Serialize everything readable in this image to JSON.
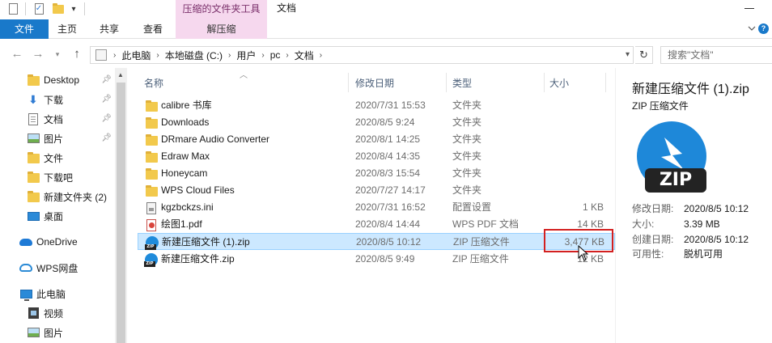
{
  "window": {
    "title": "文档",
    "context_tab_title": "压缩的文件夹工具"
  },
  "ribbon": {
    "tabs": [
      "文件",
      "主页",
      "共享",
      "查看",
      "解压缩"
    ]
  },
  "address": {
    "breadcrumbs": [
      "此电脑",
      "本地磁盘 (C:)",
      "用户",
      "pc",
      "文档"
    ],
    "search_placeholder": "搜索\"文档\""
  },
  "nav": {
    "items": [
      {
        "label": "Desktop",
        "icon": "folder-icon",
        "pinned": true
      },
      {
        "label": "下载",
        "icon": "download-icon",
        "pinned": true
      },
      {
        "label": "文档",
        "icon": "document-icon",
        "pinned": true
      },
      {
        "label": "图片",
        "icon": "picture-icon",
        "pinned": true
      },
      {
        "label": "文件",
        "icon": "folder-icon",
        "pinned": false
      },
      {
        "label": "下载吧",
        "icon": "folder-icon",
        "pinned": false
      },
      {
        "label": "新建文件夹 (2)",
        "icon": "folder-icon",
        "pinned": false
      },
      {
        "label": "桌面",
        "icon": "desktop-icon",
        "pinned": false
      },
      {
        "label": "OneDrive",
        "icon": "onedrive-icon",
        "pinned": false
      },
      {
        "label": "WPS网盘",
        "icon": "wps-cloud-icon",
        "pinned": false
      },
      {
        "label": "此电脑",
        "icon": "this-pc-icon",
        "pinned": false
      },
      {
        "label": "视频",
        "icon": "video-icon",
        "pinned": false
      },
      {
        "label": "图片",
        "icon": "picture-icon",
        "pinned": false
      }
    ]
  },
  "filelist": {
    "columns": [
      "名称",
      "修改日期",
      "类型",
      "大小"
    ],
    "rows": [
      {
        "name": "calibre 书库",
        "date": "2020/7/31 15:53",
        "type": "文件夹",
        "size": "",
        "icon": "folder-icon"
      },
      {
        "name": "Downloads",
        "date": "2020/8/5 9:24",
        "type": "文件夹",
        "size": "",
        "icon": "folder-icon"
      },
      {
        "name": "DRmare Audio Converter",
        "date": "2020/8/1 14:25",
        "type": "文件夹",
        "size": "",
        "icon": "folder-icon"
      },
      {
        "name": "Edraw Max",
        "date": "2020/8/4 14:35",
        "type": "文件夹",
        "size": "",
        "icon": "folder-icon"
      },
      {
        "name": "Honeycam",
        "date": "2020/8/3 15:54",
        "type": "文件夹",
        "size": "",
        "icon": "folder-icon"
      },
      {
        "name": "WPS Cloud Files",
        "date": "2020/7/27 14:17",
        "type": "文件夹",
        "size": "",
        "icon": "folder-icon"
      },
      {
        "name": "kgzbckzs.ini",
        "date": "2020/7/31 16:52",
        "type": "配置设置",
        "size": "1 KB",
        "icon": "ini-file-icon"
      },
      {
        "name": "绘图1.pdf",
        "date": "2020/8/4 14:44",
        "type": "WPS PDF 文档",
        "size": "14 KB",
        "icon": "pdf-file-icon"
      },
      {
        "name": "新建压缩文件 (1).zip",
        "date": "2020/8/5 10:12",
        "type": "ZIP 压缩文件",
        "size": "3,477 KB",
        "icon": "zip-file-icon",
        "selected": true
      },
      {
        "name": "新建压缩文件.zip",
        "date": "2020/8/5 9:49",
        "type": "ZIP 压缩文件",
        "size": "12 KB",
        "icon": "zip-file-icon"
      }
    ]
  },
  "preview": {
    "title": "新建压缩文件 (1).zip",
    "type": "ZIP 压缩文件",
    "icon_label": "ZIP",
    "meta": [
      {
        "key": "修改日期:",
        "value": "2020/8/5 10:12"
      },
      {
        "key": "大小:",
        "value": "3.39 MB"
      },
      {
        "key": "创建日期:",
        "value": "2020/8/5 10:12"
      },
      {
        "key": "可用性:",
        "value": "脱机可用"
      }
    ]
  },
  "colors": {
    "accent": "#1979ca",
    "context_tab": "#f6d8ee",
    "selection": "#cce8ff",
    "highlight_box": "#d32020"
  }
}
